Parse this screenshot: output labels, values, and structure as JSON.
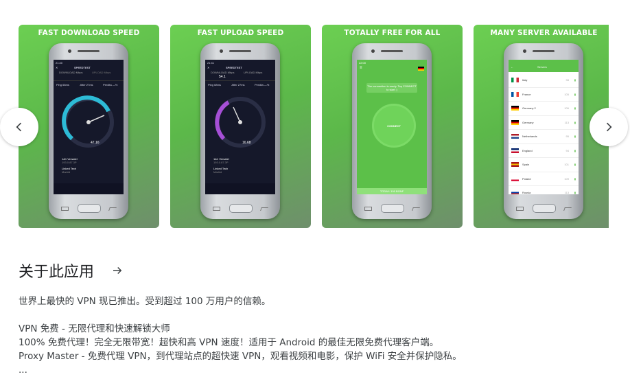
{
  "screenshots": [
    {
      "caption": "FAST DOWNLOAD SPEED",
      "app": "SPEEDTEST",
      "time": "21:40",
      "metrics": [
        "DOWNLOAD Mbps",
        "UPLOAD Mbps"
      ],
      "ping": "Ping 68ms",
      "jitter": "Jitter 27ms",
      "loss": "Perdita —%",
      "reading": "47.16",
      "isp": "1&1 Versatel",
      "ip": "193.0.87.3P",
      "server": "Linked Tech",
      "city": "Madrid",
      "tabs": [
        "Velocità",
        "Video",
        "VPN",
        "Mappa"
      ],
      "accent": "#2dbbd6"
    },
    {
      "caption": "FAST UPLOAD SPEED",
      "app": "SPEEDTEST",
      "time": "21:41",
      "metrics": [
        "DOWNLOAD Mbps",
        "UPLOAD Mbps"
      ],
      "top_value": "54.1",
      "ping": "Ping 68ms",
      "jitter": "Jitter 27ms",
      "loss": "Perdita —%",
      "reading": "16.68",
      "isp": "1&1 Versatel",
      "ip": "193.0.87.3P",
      "server": "Linked Tech",
      "city": "Madrid",
      "tabs": [
        "Velocità",
        "Video",
        "VPN",
        "Mappa"
      ],
      "accent": "#a64fd6"
    },
    {
      "caption": "TOTALLY FREE FOR ALL",
      "time": "22:00",
      "tip": "The connection is ready. Tap CONNECT to start :)",
      "connect": "CONNECT",
      "footer": "TODAY: 100 BONF"
    },
    {
      "caption": "MANY SERVER AVAILABLE",
      "header": "Servers",
      "servers": [
        "Italy",
        "France",
        "Germany 2",
        "Germany",
        "Netherlands",
        "England",
        "Spain",
        "Poland",
        "Russia"
      ],
      "pings": [
        "98",
        "105",
        "106",
        "113",
        "95",
        "94",
        "101",
        "109",
        "113"
      ]
    }
  ],
  "about": {
    "title": "关于此应用",
    "lines": [
      "世界上最快的 VPN 现已推出。受到超过 100 万用户的信赖。",
      "VPN 免费 - 无限代理和快速解锁大师",
      "100% 免费代理！完全无限带宽！超快和高 VPN 速度！适用于 Android 的最佳无限免费代理客户端。",
      "Proxy Master - 免费代理 VPN，到代理站点的超快速 VPN，观看视频和电影，保护 WiFi 安全并保护隐私。",
      "..."
    ]
  },
  "nav": {
    "prev": "chevron-left-icon",
    "next": "chevron-right-icon"
  }
}
